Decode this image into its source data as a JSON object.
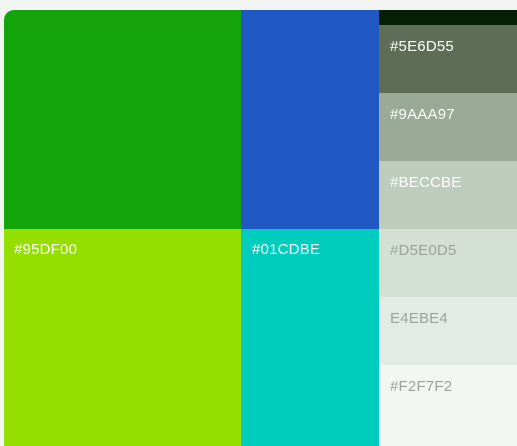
{
  "palette": {
    "swatches": {
      "green": {
        "hex": "#13A40A",
        "label": ""
      },
      "lime": {
        "hex": "#95DF00",
        "label": "#95DF00",
        "text_color": "#ffffff"
      },
      "blue": {
        "hex": "#2159C4",
        "label": ""
      },
      "cyan": {
        "hex": "#01CDBE",
        "label": "#01CDBE",
        "text_color": "#ffffff"
      },
      "dark": {
        "hex": "#062006",
        "label": ""
      },
      "s1": {
        "hex": "#5E6D55",
        "label": "#5E6D55",
        "text_color": "#ffffff"
      },
      "s2": {
        "hex": "#9AAA97",
        "label": "#9AAA97",
        "text_color": "#ffffff"
      },
      "s3": {
        "hex": "#BECCBE",
        "label": "#BECCBE",
        "text_color": "#ffffff"
      },
      "s4": {
        "hex": "#D5E0D5",
        "label": "#D5E0D5",
        "text_color": "#9aa39a"
      },
      "s5": {
        "hex": "#E4EBE4",
        "label": "E4EBE4",
        "text_color": "#9aa39a"
      },
      "s6": {
        "hex": "#F2F7F2",
        "label": "#F2F7F2",
        "text_color": "#9aa39a"
      }
    }
  }
}
